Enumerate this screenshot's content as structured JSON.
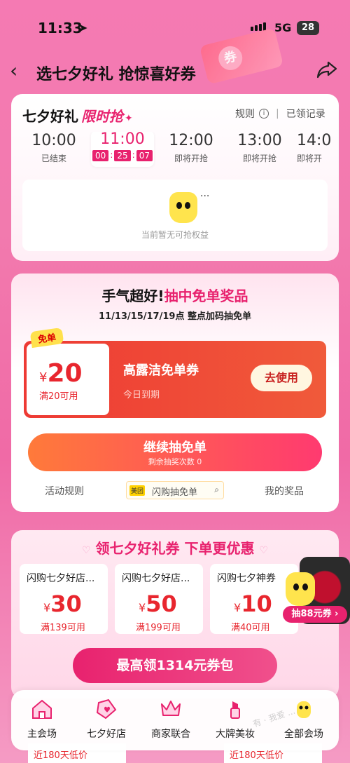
{
  "status": {
    "time": "11:33",
    "network": "5G",
    "battery": "28"
  },
  "header": {
    "title": "选七夕好礼 抢惊喜好券",
    "deco_text": "券"
  },
  "flash": {
    "title": "七夕好礼",
    "title_hot": "限时抢",
    "rules": "规则",
    "received": "已领记录",
    "slots": [
      {
        "time": "10:00",
        "status": "已结束"
      },
      {
        "time": "11:00",
        "cd_h": "00",
        "cd_m": "25",
        "cd_s": "07"
      },
      {
        "time": "12:00",
        "status": "即将开抢"
      },
      {
        "time": "13:00",
        "status": "即将开抢"
      },
      {
        "time": "14:0",
        "status": "即将开"
      }
    ],
    "empty_dots": "...",
    "empty_text": "当前暂无可抢权益"
  },
  "lottery": {
    "head_a": "手气超好!",
    "head_b": "抽中免单奖品",
    "sub": "11/13/15/17/19点 整点加码抽免单",
    "coupon": {
      "tag": "免单",
      "yen": "¥",
      "amount": "20",
      "condition": "满20可用",
      "name": "高露洁免单券",
      "expire": "今日到期",
      "use": "去使用"
    },
    "draw": {
      "label": "继续抽免单",
      "remain": "剩余抽奖次数 0"
    },
    "footer": {
      "rules": "活动规则",
      "search_tag": "美团",
      "search": "闪购抽免单",
      "prizes": "我的奖品"
    }
  },
  "coupons": {
    "head": "领七夕好礼券 下单更优惠",
    "heart": "♡",
    "items": [
      {
        "name": "闪购七夕好店...",
        "yen": "¥",
        "amount": "30",
        "cond": "满139可用"
      },
      {
        "name": "闪购七夕好店...",
        "yen": "¥",
        "amount": "50",
        "cond": "满199可用"
      },
      {
        "name": "闪购七夕神券",
        "yen": "¥",
        "amount": "10",
        "cond": "满40可用"
      }
    ],
    "button": "最高领1314元券包",
    "lucky": "抽88元券 ›"
  },
  "peek": {
    "a": "近180天低价",
    "b": "近180天低价"
  },
  "tabs": [
    {
      "label": "主会场",
      "icon": "home-icon"
    },
    {
      "label": "七夕好店",
      "icon": "tag-icon"
    },
    {
      "label": "商家联合",
      "icon": "crown-icon"
    },
    {
      "label": "大牌美妆",
      "icon": "lipstick-icon"
    },
    {
      "label": "全部会场",
      "icon": "mascot-icon"
    }
  ],
  "watermark": "有 · 我爱 ..."
}
